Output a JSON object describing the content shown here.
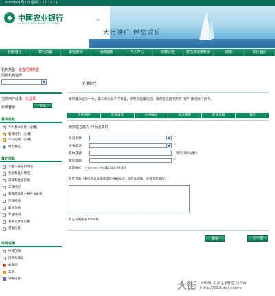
{
  "topbar": {
    "date_text": "2009年01月3日 星期二 12:12 11"
  },
  "header": {
    "bank_name_cn": "中国农业银行",
    "bank_name_en": "AGRICULTURAL BANK OF CHINA",
    "slogan": "大行德广 伴您成长",
    "accent_color": "#0e8a5f"
  },
  "nav": {
    "items": [
      "招聘首页",
      "农行风貌",
      "职位查询",
      "招聘指南",
      "个人中心",
      "招聘公告",
      "意向及结果查询",
      "通知",
      "农行首页"
    ]
  },
  "sidebar": {
    "region_label": "机构类型：",
    "region_note": "省直招聘类型",
    "org_select_label": "招聘机构选择：",
    "org_select_value": "",
    "user_label": "当前用户状态：",
    "user_status": "未登录",
    "login_label": "系统登录：",
    "login_button": "登录",
    "basic_section": "基本信息",
    "basic_items": [
      "个人基本信息（必填）",
      "教育经历（必填）",
      "学习成绩（必填）",
      "简历预览"
    ],
    "other_section": "其它信息",
    "other_items": [
      "学生干部任职情况",
      "奖励和处分情况",
      "实践和社会实践",
      "工作经历",
      "家庭成员及主要社会关系",
      "项目经验",
      "职业资格",
      "专业培训",
      "发表论文或论著",
      "其他信息"
    ],
    "legend_section": "符号说明",
    "legend_items": [
      "项目已填",
      "项目未填写",
      "必填项",
      "帮助",
      "详细内容"
    ]
  },
  "main": {
    "breadcrumb": "外语能力",
    "notice": "每页最多显示一条，第二条信息不予受理。所有页面填完后，请点击页面下方的\"保存\"按钮进行保存。",
    "table_headers": [
      "外语语种",
      "外语类型",
      "证书编号",
      "具体成绩",
      "获证日期",
      "操作"
    ],
    "form_title": "增加语言能力（*为必填项）",
    "fields": [
      {
        "label": "外语语种：",
        "value": "",
        "required": true
      },
      {
        "label": "证书类型：",
        "value": "",
        "required": true
      },
      {
        "label": "具体成绩：",
        "value": "",
        "hint": "（填写具体分数）"
      },
      {
        "label": "获证日期：",
        "value": "",
        "required": true
      }
    ],
    "date_format_hint": "日期格式：yyyy-mm-dd 如2008-08-13",
    "other_label": "其它说明（未提供具体成绩或证书编号的，请在此说明，否则无需填写）",
    "char_limit_note": "其它说明最多1000字。",
    "save_button": "保存",
    "next_button": "下一页"
  },
  "watermark": {
    "logo": "大街",
    "line1": "大街网-大学生求职互动平台",
    "line2": "http://2011.dajie.com"
  }
}
